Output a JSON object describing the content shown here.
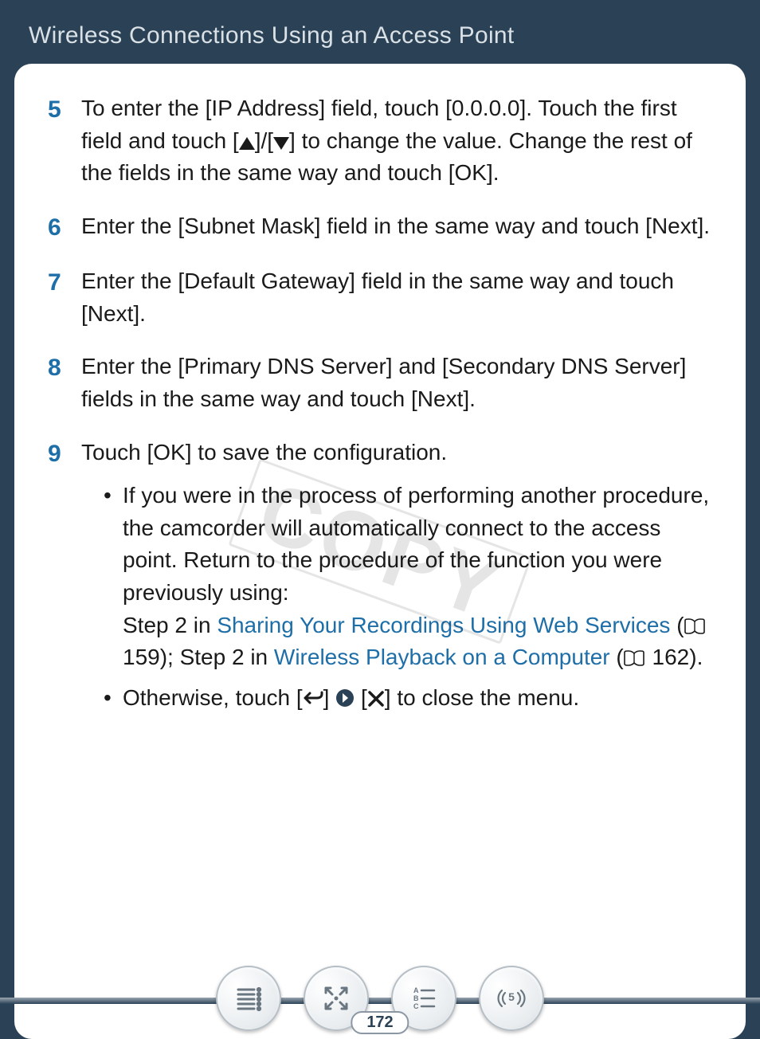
{
  "header": {
    "title": "Wireless Connections Using an Access Point"
  },
  "watermark": "COPY",
  "steps": [
    {
      "num": "5",
      "text_before_tri": "To enter the [IP Address] field, touch [0.0.0.0]. Touch the first field and touch [",
      "text_between_tri": "]/[",
      "text_after_tri": "] to change the value. Change the rest of the fields in the same way and touch [OK]."
    },
    {
      "num": "6",
      "text": "Enter the [Subnet Mask] field in the same way and touch [Next]."
    },
    {
      "num": "7",
      "text": "Enter the [Default Gateway] field in the same way and touch [Next]."
    },
    {
      "num": "8",
      "text": "Enter the [Primary DNS Server] and [Secondary DNS Server] fields in the same way and touch [Next]."
    },
    {
      "num": "9",
      "text": "Touch [OK] to save the configuration.",
      "sub": {
        "item1": {
          "para1": "If you were in the process of performing another procedure, the camcorder will automatically connect to the access point. Return to the procedure of the function you were previously using:",
          "line2_prefix": "Step 2 in ",
          "link1": "Sharing Your Recordings Using Web Services",
          "line2_after_link1_open": " (",
          "ref1": " 159); Step 2 in ",
          "link2": "Wireless Playback on a Computer",
          "line2_after_link2_open": " (",
          "ref2": " 162)."
        },
        "item2": {
          "prefix": "Otherwise, touch [",
          "mid1": "] ",
          "mid2": " [",
          "suffix": "] to close the menu."
        }
      }
    }
  ],
  "page_number": "172"
}
